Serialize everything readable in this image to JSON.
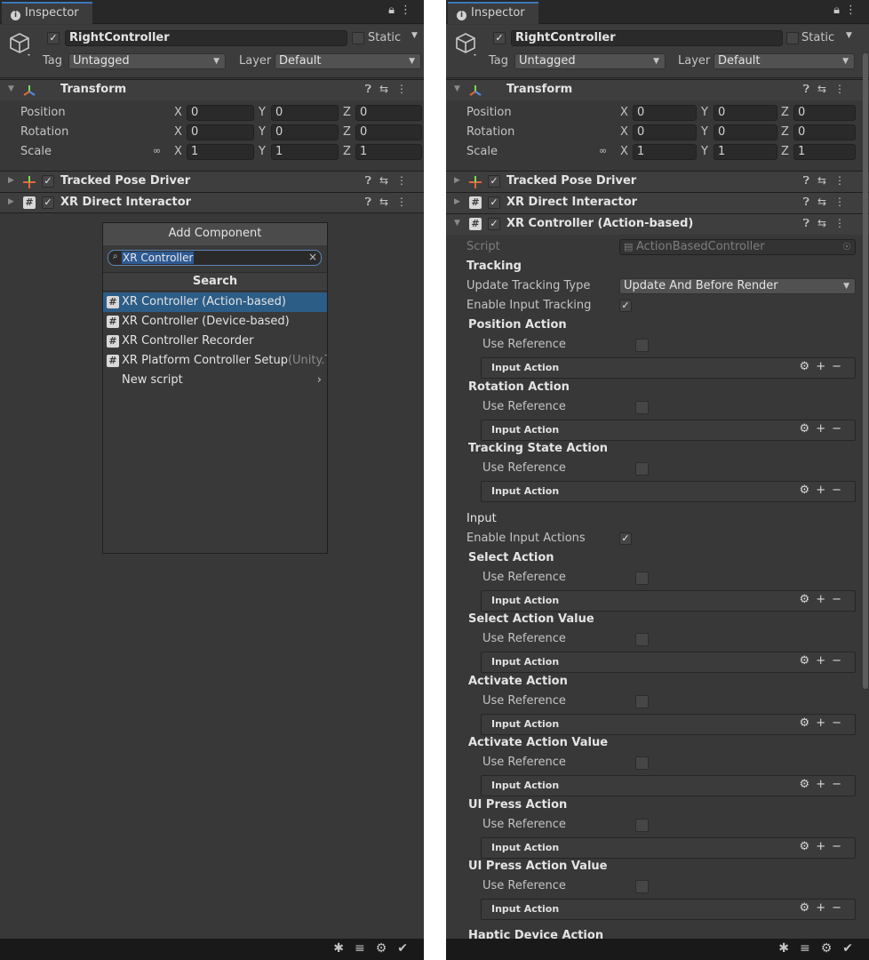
{
  "colors": {
    "panel_bg": "#383838",
    "selection": "#2c5d87",
    "tab_accent": "#3a79bb",
    "search_border": "#5e87b8"
  },
  "inspector": {
    "tab_label": "Inspector",
    "object_name": "RightController",
    "static_label": "Static",
    "tag_label": "Tag",
    "tag_value": "Untagged",
    "layer_label": "Layer",
    "layer_value": "Default"
  },
  "transform": {
    "title": "Transform",
    "position_label": "Position",
    "rotation_label": "Rotation",
    "scale_label": "Scale",
    "position": {
      "x": "0",
      "y": "0",
      "z": "0"
    },
    "rotation": {
      "x": "0",
      "y": "0",
      "z": "0"
    },
    "scale": {
      "x": "1",
      "y": "1",
      "z": "1"
    },
    "axis_x": "X",
    "axis_y": "Y",
    "axis_z": "Z"
  },
  "components": {
    "tracked_pose_driver": "Tracked Pose Driver",
    "xr_direct_interactor": "XR Direct Interactor",
    "xr_controller": "XR Controller (Action-based)"
  },
  "add_component": {
    "button_label": "Add Component",
    "search_text": "XR Controller",
    "section_title": "Search",
    "items": [
      {
        "label": "XR Controller (Action-based)"
      },
      {
        "label": "XR Controller (Device-based)"
      },
      {
        "label": "XR Controller Recorder"
      },
      {
        "label": "XR Platform Controller Setup",
        "suffix": "(Unity.Te"
      }
    ],
    "new_script": "New script"
  },
  "xr_controller": {
    "script_label": "Script",
    "script_value": "ActionBasedController",
    "tracking_header": "Tracking",
    "update_tracking_type_label": "Update Tracking Type",
    "update_tracking_type_value": "Update And Before Render",
    "enable_input_tracking_label": "Enable Input Tracking",
    "input_header": "Input",
    "enable_input_actions_label": "Enable Input Actions",
    "use_reference_label": "Use Reference",
    "input_action_label": "Input Action",
    "actions": [
      {
        "name": "Position Action"
      },
      {
        "name": "Rotation Action"
      },
      {
        "name": "Tracking State Action"
      },
      {
        "name": "Select Action"
      },
      {
        "name": "Select Action Value"
      },
      {
        "name": "Activate Action"
      },
      {
        "name": "Activate Action Value"
      },
      {
        "name": "UI Press Action"
      },
      {
        "name": "UI Press Action Value"
      }
    ],
    "cut_off_label": "Haptic Device Action"
  }
}
